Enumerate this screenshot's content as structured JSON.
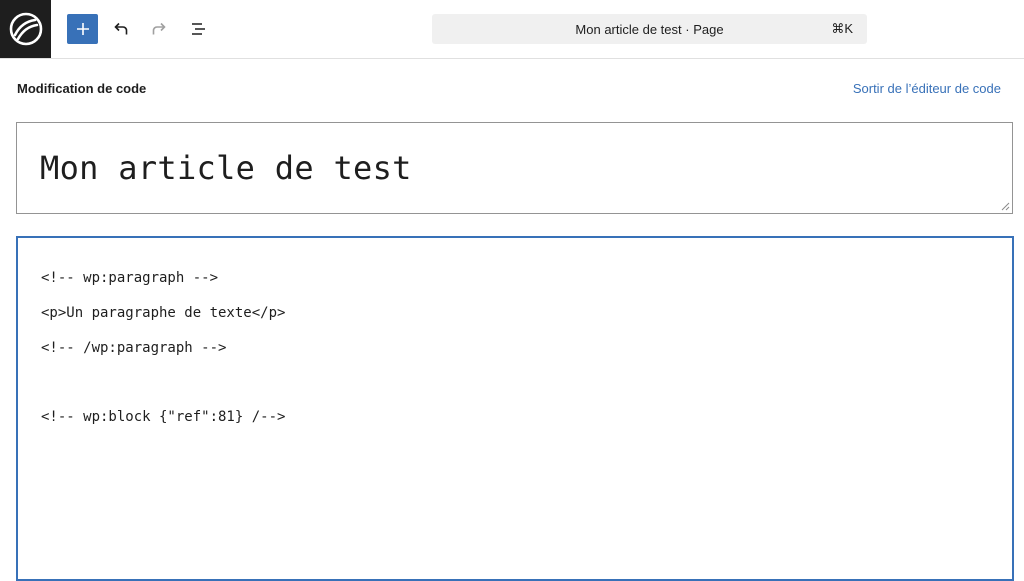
{
  "topbar": {
    "logo_icon": "site-logo-icon",
    "add_icon": "plus-icon",
    "undo_icon": "undo-icon",
    "redo_icon": "redo-icon",
    "list_icon": "document-overview-icon",
    "command_bar_label": "Mon article de test · Page",
    "shortcut": "⌘K",
    "accent_color": "#3871b8"
  },
  "code_editor": {
    "header_title": "Modification de code",
    "exit_label": "Sortir de l’éditeur de code",
    "post_title": "Mon article de test",
    "lines": [
      "<!-- wp:paragraph -->",
      "<p>Un paragraphe de texte</p>",
      "<!-- /wp:paragraph -->",
      "",
      "<!-- wp:block {\"ref\":81} /-->"
    ]
  }
}
